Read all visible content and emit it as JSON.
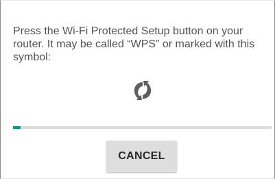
{
  "dialog": {
    "message": "Press the Wi-Fi Protected Setup button on your router. It may be called “WPS” or marked with this symbol:",
    "icon": "wps-sync-icon",
    "progress": 0.03,
    "cancel_label": "CANCEL"
  },
  "colors": {
    "text": "#545454",
    "accent": "#1f8f86",
    "track": "#dcdcdc",
    "button": "#dedede",
    "icon": "#5f5f5f"
  }
}
